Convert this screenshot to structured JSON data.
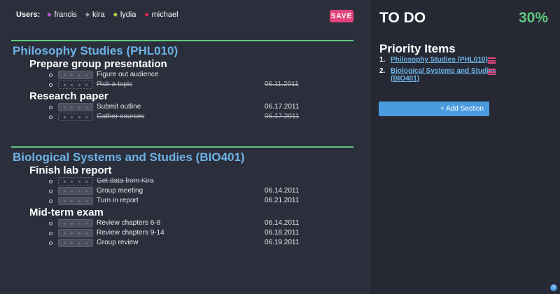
{
  "users": {
    "label": "Users:",
    "list": [
      {
        "name": "francis",
        "color": "#b65cd6"
      },
      {
        "name": "kira",
        "color": "#9a9da8"
      },
      {
        "name": "lydia",
        "color": "#c8d64a"
      },
      {
        "name": "michael",
        "color": "#e2294f"
      }
    ]
  },
  "toolbar": {
    "save_label": "SAVE"
  },
  "sections": [
    {
      "title": "Philosophy Studies (PHL010)",
      "groups": [
        {
          "title": "Prepare group presentation",
          "tasks": [
            {
              "label": "Figure out audience",
              "date": "",
              "done": false
            },
            {
              "label": "Pick a topic",
              "date": "06.11.2011",
              "done": true
            }
          ]
        },
        {
          "title": "Research paper",
          "tasks": [
            {
              "label": "Submit outline",
              "date": "06.17.2011",
              "done": false
            },
            {
              "label": "Gather sources",
              "date": "06.17.2011",
              "done": true
            }
          ]
        }
      ]
    },
    {
      "title": "Biological Systems and Studies (BIO401)",
      "groups": [
        {
          "title": "Finish lab report",
          "tasks": [
            {
              "label": "Get data from Kira",
              "date": "",
              "done": true
            },
            {
              "label": "Group meeting",
              "date": "06.14.2011",
              "done": false
            },
            {
              "label": "Turn in report",
              "date": "06.21.2011",
              "done": false
            }
          ]
        },
        {
          "title": "Mid-term exam",
          "tasks": [
            {
              "label": "Review chapters 6-8",
              "date": "06.14.2011",
              "done": false
            },
            {
              "label": "Review chapters 9-14",
              "date": "06.18.2011",
              "done": false
            },
            {
              "label": "Group review",
              "date": "06.19.2011",
              "done": false
            }
          ]
        }
      ]
    }
  ],
  "panel": {
    "title": "TO DO",
    "percent": "30%",
    "priority_title": "Priority Items",
    "priority_items": [
      {
        "num": "1.",
        "label": "Philosophy Studies (PHL010)"
      },
      {
        "num": "2.",
        "label": "Biological Systems and Studies (BIO401)"
      }
    ],
    "add_section_label": "+ Add Section",
    "help_label": "?"
  },
  "colors": {
    "accent_green": "#5fc87f",
    "accent_blue": "#6db3e6",
    "accent_pink": "#e2457d",
    "button_blue": "#4a9be0"
  }
}
